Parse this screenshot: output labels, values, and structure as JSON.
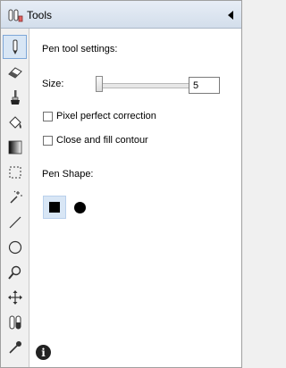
{
  "window": {
    "title": "Tools"
  },
  "tools": [
    {
      "name": "pen",
      "selected": true
    },
    {
      "name": "eraser"
    },
    {
      "name": "brush"
    },
    {
      "name": "fill"
    },
    {
      "name": "gradient"
    },
    {
      "name": "selection"
    },
    {
      "name": "magic-wand"
    },
    {
      "name": "line"
    },
    {
      "name": "ellipse"
    },
    {
      "name": "zoom"
    },
    {
      "name": "move"
    },
    {
      "name": "color-swap"
    },
    {
      "name": "eyedropper"
    }
  ],
  "settings": {
    "heading": "Pen tool settings:",
    "size_label": "Size:",
    "size_value": "5",
    "size_slider_fraction": 0.02,
    "pixel_perfect_label": "Pixel perfect correction",
    "pixel_perfect_checked": false,
    "close_fill_label": "Close and fill contour",
    "close_fill_checked": false,
    "shape_label": "Pen Shape:",
    "shapes": [
      {
        "name": "square",
        "selected": true
      },
      {
        "name": "circle",
        "selected": false
      }
    ]
  },
  "info_glyph": "i",
  "colors": {
    "selection_bg": "#d8e6f5",
    "selection_border": "#7ea7d8"
  }
}
